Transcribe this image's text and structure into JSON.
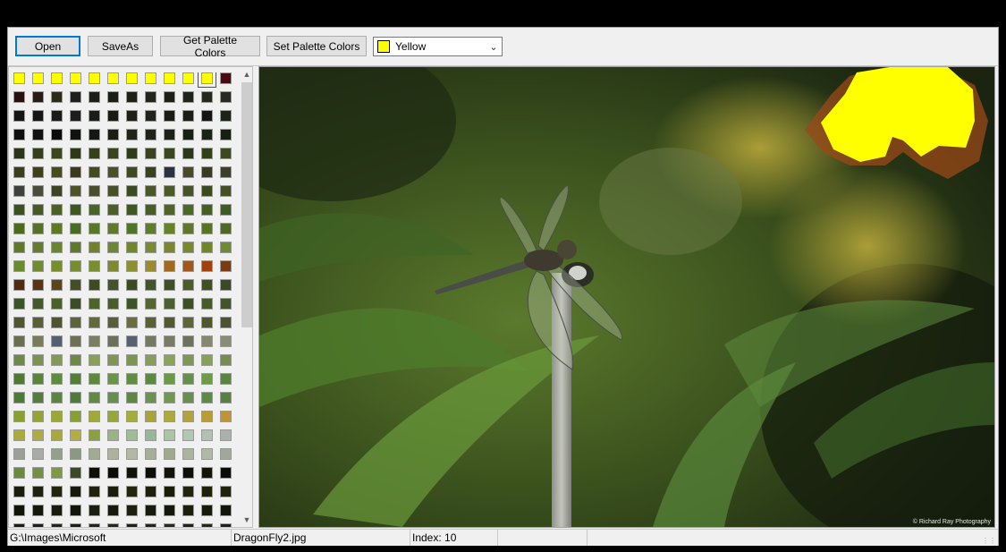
{
  "toolbar": {
    "open_label": "Open",
    "saveas_label": "SaveAs",
    "get_palette_label": "Get Palette Colors",
    "set_palette_label": "Set Palette Colors"
  },
  "color_select": {
    "selected": "Yellow",
    "swatch_color": "#ffff00"
  },
  "palette": {
    "columns": 12,
    "selected_index": 10,
    "colors": [
      "#ffff00",
      "#ffff00",
      "#ffff00",
      "#ffff00",
      "#ffff00",
      "#ffff00",
      "#ffff00",
      "#ffff00",
      "#ffff00",
      "#ffff00",
      "#ffff00",
      "#4a0a12",
      "#2a0f10",
      "#2b1a14",
      "#2e2a16",
      "#1e1e1a",
      "#1c1f18",
      "#1a1f16",
      "#1e2216",
      "#22261a",
      "#1c2014",
      "#1e2418",
      "#23281c",
      "#262a20",
      "#141414",
      "#161616",
      "#1a1a1a",
      "#1c1c1c",
      "#1a1c18",
      "#181a14",
      "#1e2018",
      "#20241a",
      "#181c14",
      "#1a1e16",
      "#141414",
      "#1a2414",
      "#0e0e0e",
      "#121212",
      "#0a0a0a",
      "#101210",
      "#151715",
      "#1a1d16",
      "#20241a",
      "#1e2218",
      "#1c2016",
      "#182014",
      "#1a2416",
      "#162012",
      "#2a3418",
      "#34401c",
      "#3c461e",
      "#2e3a16",
      "#34401a",
      "#38441c",
      "#2e3c18",
      "#38441e",
      "#3a4620",
      "#2a3818",
      "#32401a",
      "#3a4a1e",
      "#3a3e1e",
      "#423e16",
      "#4a4a1c",
      "#3c3a1a",
      "#444a22",
      "#4a5224",
      "#3e4a22",
      "#38421c",
      "#2a3440",
      "#4a4a26",
      "#3a3a22",
      "#3c3e2a",
      "#3e403e",
      "#4a4c3c",
      "#3e4226",
      "#4e5428",
      "#4a4e2c",
      "#485026",
      "#3c4a24",
      "#4a5828",
      "#4c5a2a",
      "#465426",
      "#3c4a22",
      "#445024",
      "#3c5020",
      "#445c22",
      "#4a6224",
      "#3c5a1e",
      "#486428",
      "#4c6026",
      "#3e5822",
      "#466024",
      "#506428",
      "#486a24",
      "#446022",
      "#3e5c20",
      "#4a6a1e",
      "#547424",
      "#5a7a26",
      "#4a6c22",
      "#56782a",
      "#5c7c2a",
      "#52742a",
      "#5a7e2c",
      "#648428",
      "#5e7a26",
      "#587226",
      "#4e6a22",
      "#5c7a2a",
      "#667c2c",
      "#6a8430",
      "#5e782c",
      "#72802e",
      "#6c8830",
      "#72862e",
      "#7a8a30",
      "#7e8430",
      "#768a2c",
      "#708628",
      "#6e8a32",
      "#6a8a2e",
      "#708c30",
      "#748e30",
      "#788c2c",
      "#7a8e30",
      "#7e8a2c",
      "#8c9030",
      "#9a8c2a",
      "#a06a1e",
      "#a4561a",
      "#a0420e",
      "#7a3a12",
      "#502a12",
      "#5a3412",
      "#5a461a",
      "#445024",
      "#3e4a20",
      "#445428",
      "#3c4c22",
      "#42542a",
      "#3e5026",
      "#4a5c28",
      "#405024",
      "#3a4a22",
      "#3c5228",
      "#44582a",
      "#4a602c",
      "#3a4e24",
      "#4e622c",
      "#485e2a",
      "#3e5426",
      "#52662e",
      "#4a6030",
      "#3c5028",
      "#465a2c",
      "#40562a",
      "#50562e",
      "#5a6034",
      "#4e5630",
      "#5c6438",
      "#626a3c",
      "#585e36",
      "#6a6e3e",
      "#5a6232",
      "#545a30",
      "#5e6636",
      "#50562e",
      "#4a5430",
      "#6a6e50",
      "#7a7c58",
      "#56606a",
      "#6e7054",
      "#7a7e62",
      "#6c7056",
      "#566270",
      "#747a60",
      "#787c64",
      "#6e7258",
      "#848870",
      "#8a8c74",
      "#6e8a48",
      "#78944e",
      "#829a54",
      "#6c8a46",
      "#88a05a",
      "#7e9852",
      "#7a9650",
      "#84a058",
      "#8aa45c",
      "#7c9852",
      "#86a25a",
      "#72904c",
      "#4e7a36",
      "#58843c",
      "#608a42",
      "#527e38",
      "#5e8840",
      "#6a9448",
      "#628c44",
      "#5a8a3e",
      "#6c984a",
      "#64904a",
      "#6e9a4c",
      "#58863e",
      "#4a7a36",
      "#527e3a",
      "#5a8440",
      "#4e7c38",
      "#608a42",
      "#66904a",
      "#5c8842",
      "#6a944c",
      "#70984e",
      "#68904a",
      "#5e8a44",
      "#56823e",
      "#8aa030",
      "#94a434",
      "#9ca836",
      "#86a032",
      "#a0aa38",
      "#98a836",
      "#a4ac3a",
      "#a8a438",
      "#acaa3a",
      "#b2a43a",
      "#b89c36",
      "#c09432",
      "#aaac3a",
      "#b0ac3e",
      "#a8a83c",
      "#b4ae40",
      "#8ca040",
      "#98b480",
      "#a0bc94",
      "#96b898",
      "#acc4a4",
      "#b0c8b0",
      "#b4c0b4",
      "#aab0aa",
      "#9c9e98",
      "#a8aca4",
      "#94a08a",
      "#8a9a80",
      "#a0aa94",
      "#acb29c",
      "#b2b8a2",
      "#a4ae98",
      "#9eaa90",
      "#aab49e",
      "#b0b8a6",
      "#a0a89a",
      "#6a8a3c",
      "#729242",
      "#7a9a46",
      "#3a4a22",
      "#0e1008",
      "#0a0c06",
      "#101208",
      "#0c0e08",
      "#121408",
      "#0e1008",
      "#141608",
      "#0a0c06",
      "#1a1c0e",
      "#1e2010",
      "#22240e",
      "#181a0c",
      "#20220e",
      "#1c1e0c",
      "#24260e",
      "#1e200c",
      "#1a1c0a",
      "#22240c",
      "#1e200a",
      "#20220c",
      "#101408",
      "#14180a",
      "#181c0c",
      "#12160a",
      "#1a1e0c",
      "#161a0a",
      "#1c200c",
      "#181c0a",
      "#141808",
      "#1a1e0a",
      "#161a08",
      "#121608",
      "#1a1e14",
      "#1e2216",
      "#222618",
      "#1c2014",
      "#20241a",
      "#242818",
      "#1e2216",
      "#222618",
      "#262a1a",
      "#202418",
      "#242816",
      "#1e2214"
    ]
  },
  "image_panel": {
    "credit": "© Richard Ray Photography"
  },
  "status": {
    "folder": "G:\\Images\\Microsoft",
    "file": "DragonFly2.jpg",
    "index": "Index: 10"
  }
}
